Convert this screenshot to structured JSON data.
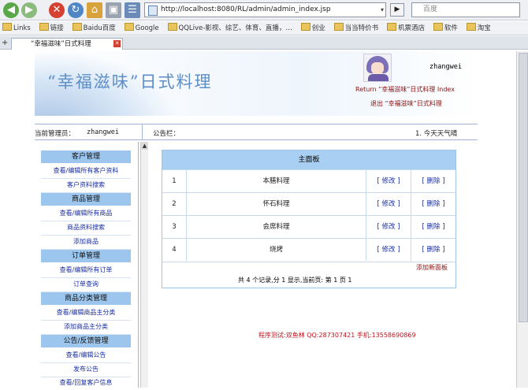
{
  "browser": {
    "address": "http://localhost:8080/RL/admin/admin_index.jsp",
    "search_placeholder": "百度",
    "bookmarks": [
      "Links",
      "链接",
      "Baidu百度",
      "Google",
      "QQLive-影视、综艺、体育、直播，…",
      "创业",
      "当当特价书",
      "机票酒店",
      "软件",
      "淘宝"
    ],
    "tab_title": "“幸福滋味”日式料理"
  },
  "header": {
    "title": "“幸福滋味”日式料理",
    "username": "zhangwei",
    "return_link": "Return “幸福滋味”日式料理 Index",
    "logout_link": "退出 “幸福滋味”日式料理"
  },
  "info": {
    "admin_label": "当前管理员：",
    "admin_name": "zhangwei",
    "notice_label": "公告栏：",
    "notice_text": "1. 今天天气晴"
  },
  "sidebar": {
    "sections": [
      {
        "title": "客户管理",
        "items": [
          "查看/编辑所有客户资料",
          "客户资料搜索"
        ]
      },
      {
        "title": "商品管理",
        "items": [
          "查看/编辑所有商品",
          "商品资料搜索",
          "添加商品"
        ]
      },
      {
        "title": "订单管理",
        "items": [
          "查看/编辑所有订单",
          "订单查询"
        ]
      },
      {
        "title": "商品分类管理",
        "items": [
          "查看/编辑商品主分类",
          "添加商品主分类"
        ]
      },
      {
        "title": "公告/反馈管理",
        "items": [
          "查看/编辑公告",
          "发布公告",
          "查看/回复客户信息"
        ]
      }
    ]
  },
  "panel": {
    "title": "主面板",
    "rows": [
      {
        "index": "1",
        "name": "本膳料理",
        "edit": "[ 修改 ]",
        "delete": "[ 删除 ]"
      },
      {
        "index": "2",
        "name": "怀石料理",
        "edit": "[ 修改 ]",
        "delete": "[ 删除 ]"
      },
      {
        "index": "3",
        "name": "会席料理",
        "edit": "[ 修改 ]",
        "delete": "[ 删除 ]"
      },
      {
        "index": "4",
        "name": "烧烤",
        "edit": "[ 修改 ]",
        "delete": "[ 删除 ]"
      }
    ],
    "add_link": "添加新面板",
    "pager": "共 4 个记录,分 1 显示,当前页: 第 1 页   1"
  },
  "footer": {
    "text": "程序测试:双鱼林 QQ:287307421 手机:13558690869"
  },
  "icons": {
    "back": "back-arrow-icon",
    "forward": "forward-arrow-icon",
    "stop": "stop-icon",
    "home": "home-icon"
  }
}
